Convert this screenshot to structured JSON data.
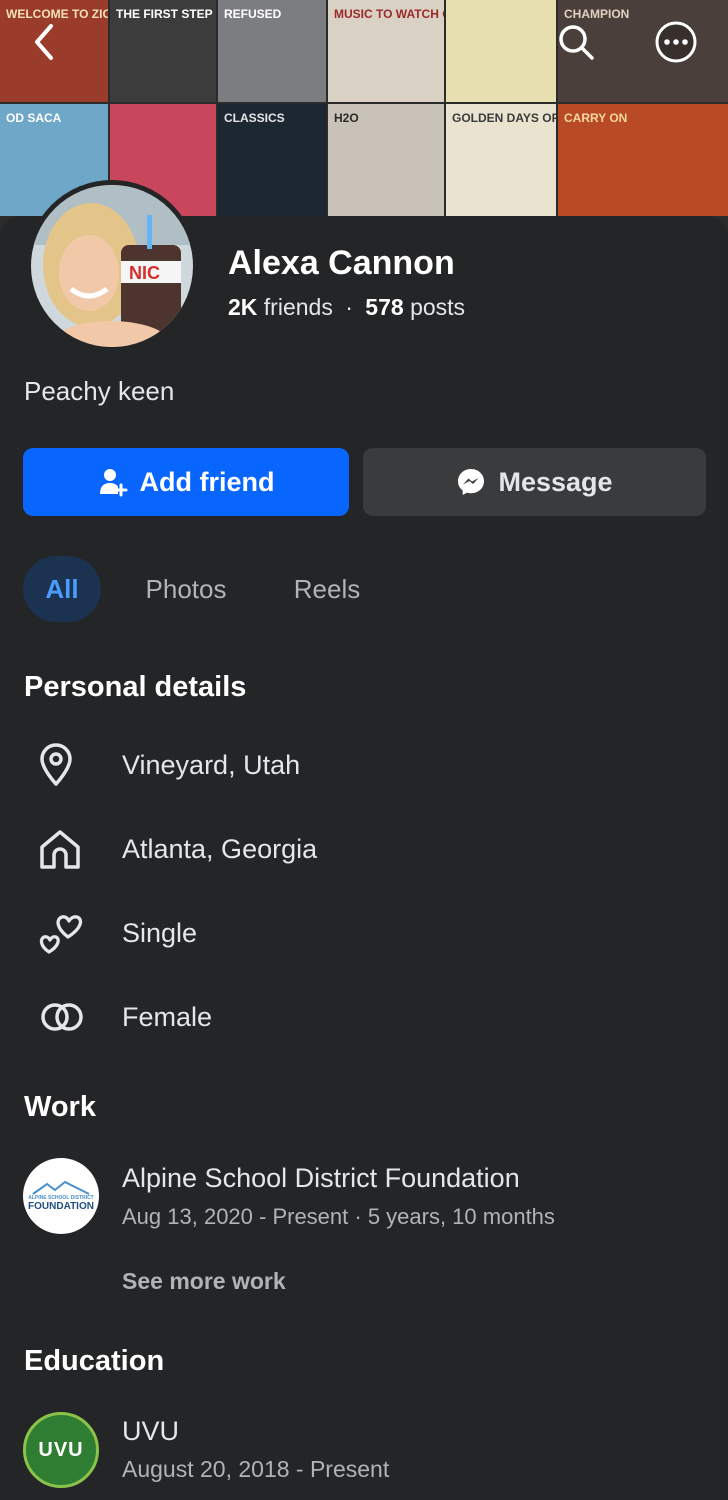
{
  "cover": {
    "albums": [
      {
        "title": "WELCOME TO ZICHERLAND",
        "bg": "#9a3b2c",
        "fg": "#f2e0b8"
      },
      {
        "title": "THE FIRST STEP",
        "bg": "#3c3c3c",
        "fg": "#ffffff"
      },
      {
        "title": "REFUSED",
        "bg": "#7b7d80",
        "fg": "#ffffff"
      },
      {
        "title": "MUSIC TO WATCH GIRLS BY",
        "bg": "#d9d1c4",
        "fg": "#9b2a2a"
      },
      {
        "title": "",
        "bg": "#e8dfb0",
        "fg": "#222222"
      },
      {
        "title": "CHAMPION",
        "bg": "#4a3f3a",
        "fg": "#e0d0c0"
      },
      {
        "title": "OD SACA",
        "bg": "#6fa7c9",
        "fg": "#ffffff"
      },
      {
        "title": "",
        "bg": "#c9475c",
        "fg": "#ffffff"
      },
      {
        "title": "CLASSICS",
        "bg": "#1d2731",
        "fg": "#e5e5e5"
      },
      {
        "title": "H2O",
        "bg": "#c8c2b8",
        "fg": "#2a2a2a"
      },
      {
        "title": "GOLDEN DAYS OF RADIO",
        "bg": "#e9e3cf",
        "fg": "#3b3b3b"
      },
      {
        "title": "CARRY ON",
        "bg": "#b84a26",
        "fg": "#f5d8a0"
      }
    ]
  },
  "profile": {
    "name": "Alexa Cannon",
    "friends_count": "2K",
    "friends_label": "friends",
    "separator": "·",
    "posts_count": "578",
    "posts_label": "posts",
    "bio": "Peachy keen",
    "avatar_cup_text": "NIC"
  },
  "actions": {
    "add_friend": "Add friend",
    "message": "Message"
  },
  "tabs": [
    "All",
    "Photos",
    "Reels"
  ],
  "personal_details": {
    "title": "Personal details",
    "items": [
      {
        "icon": "location-pin-icon",
        "text": "Vineyard, Utah"
      },
      {
        "icon": "home-icon",
        "text": "Atlanta, Georgia"
      },
      {
        "icon": "hearts-icon",
        "text": "Single"
      },
      {
        "icon": "gender-rings-icon",
        "text": "Female"
      }
    ]
  },
  "work": {
    "title": "Work",
    "logo_top_text": "ALPINE SCHOOL DISTRICT",
    "logo_text": "FOUNDATION",
    "employer": "Alpine School District Foundation",
    "period": "Aug 13, 2020 - Present · 5 years, 10 months",
    "see_more": "See more work"
  },
  "education": {
    "title": "Education",
    "logo_text": "UVU",
    "school": "UVU",
    "period": "August 20, 2018 - Present"
  },
  "colors": {
    "background": "#242526",
    "primary_blue": "#0866ff",
    "secondary_button": "#3a3b3c",
    "active_tab_bg": "#1c3251",
    "active_tab_text": "#4b9cff"
  }
}
